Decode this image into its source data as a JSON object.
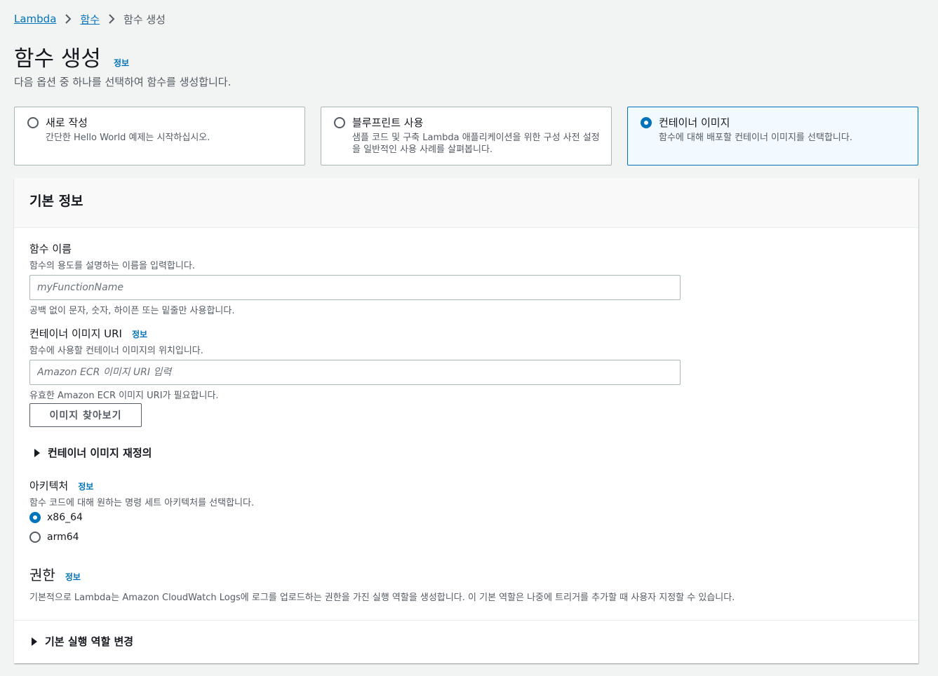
{
  "breadcrumb": {
    "items": [
      {
        "label": "Lambda",
        "link": true
      },
      {
        "label": "함수",
        "link": true
      },
      {
        "label": "함수 생성",
        "link": false
      }
    ]
  },
  "header": {
    "title": "함수 생성",
    "info_label": "정보",
    "description": "다음 옵션 중 하나를 선택하여 함수를 생성합니다."
  },
  "options": [
    {
      "label": "새로 작성",
      "description": "간단한 Hello World 예제는 시작하십시오.",
      "selected": false
    },
    {
      "label": "블루프린트 사용",
      "description": "샘플 코드 및 구축 Lambda 애플리케이션을 위한 구성 사전 설정을 일반적인 사용 사례를 살펴봅니다.",
      "selected": false
    },
    {
      "label": "컨테이너 이미지",
      "description": "함수에 대해 배포할 컨테이너 이미지를 선택합니다.",
      "selected": true
    }
  ],
  "panel": {
    "title": "기본 정보",
    "function_name": {
      "label": "함수 이름",
      "description": "함수의 용도를 설명하는 이름을 입력합니다.",
      "placeholder": "myFunctionName",
      "value": "",
      "constraint": "공백 없이 문자, 숫자, 하이픈 또는 밑줄만 사용합니다."
    },
    "image_uri": {
      "label": "컨테이너 이미지 URI",
      "info_label": "정보",
      "description": "함수에 사용할 컨테이너 이미지의 위치입니다.",
      "placeholder": "Amazon ECR 이미지 URI 입력",
      "value": "",
      "constraint": "유효한 Amazon ECR 이미지 URI가 필요합니다."
    },
    "browse_button": "이미지 찾아보기",
    "override_expander": "컨테이너 이미지 재정의",
    "architecture": {
      "label": "아키텍처",
      "info_label": "정보",
      "description": "함수 코드에 대해 원하는 명령 세트 아키텍처를 선택합니다.",
      "options": [
        {
          "label": "x86_64",
          "selected": true
        },
        {
          "label": "arm64",
          "selected": false
        }
      ]
    },
    "permissions": {
      "title": "권한",
      "info_label": "정보",
      "description": "기본적으로 Lambda는 Amazon CloudWatch Logs에 로그를 업로드하는 권한을 가진 실행 역할을 생성합니다. 이 기본 역할은 나중에 트리거를 추가할 때 사용자 지정할 수 있습니다."
    },
    "role_expander": "기본 실행 역할 변경"
  },
  "colors": {
    "link": "#0073bb",
    "selected_tile_bg": "#f1faff",
    "border": "#aab7b8"
  }
}
